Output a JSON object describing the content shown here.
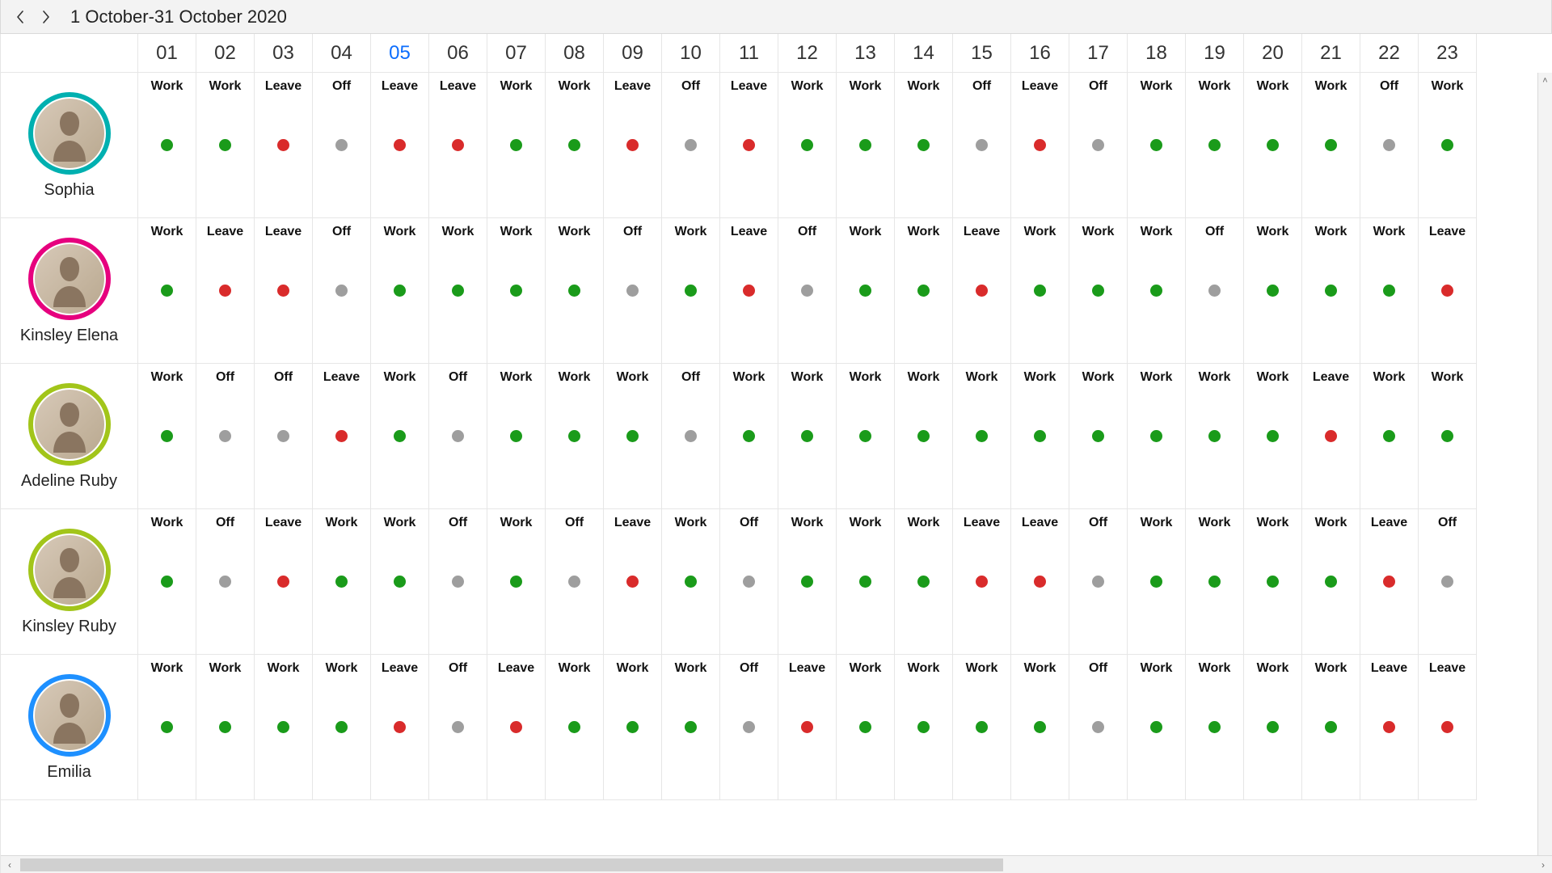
{
  "toolbar": {
    "date_range": "1 October-31 October 2020"
  },
  "today_index": 4,
  "days": [
    "01",
    "02",
    "03",
    "04",
    "05",
    "06",
    "07",
    "08",
    "09",
    "10",
    "11",
    "12",
    "13",
    "14",
    "15",
    "16",
    "17",
    "18",
    "19",
    "20",
    "21",
    "22",
    "23"
  ],
  "status_colors": {
    "Work": "#1a9b1a",
    "Leave": "#d92b2b",
    "Off": "#9e9e9e"
  },
  "employees": [
    {
      "name": "Sophia",
      "ring": "#00b0b0",
      "schedule": [
        "Work",
        "Work",
        "Leave",
        "Off",
        "Leave",
        "Leave",
        "Work",
        "Work",
        "Leave",
        "Off",
        "Leave",
        "Work",
        "Work",
        "Work",
        "Off",
        "Leave",
        "Off",
        "Work",
        "Work",
        "Work",
        "Work",
        "Off",
        "Work"
      ]
    },
    {
      "name": "Kinsley Elena",
      "ring": "#e6007e",
      "schedule": [
        "Work",
        "Leave",
        "Leave",
        "Off",
        "Work",
        "Work",
        "Work",
        "Work",
        "Off",
        "Work",
        "Leave",
        "Off",
        "Work",
        "Work",
        "Leave",
        "Work",
        "Work",
        "Work",
        "Off",
        "Work",
        "Work",
        "Work",
        "Leave"
      ]
    },
    {
      "name": "Adeline Ruby",
      "ring": "#a2c51a",
      "schedule": [
        "Work",
        "Off",
        "Off",
        "Leave",
        "Work",
        "Off",
        "Work",
        "Work",
        "Work",
        "Off",
        "Work",
        "Work",
        "Work",
        "Work",
        "Work",
        "Work",
        "Work",
        "Work",
        "Work",
        "Work",
        "Leave",
        "Work",
        "Work"
      ]
    },
    {
      "name": "Kinsley Ruby",
      "ring": "#a2c51a",
      "schedule": [
        "Work",
        "Off",
        "Leave",
        "Work",
        "Work",
        "Off",
        "Work",
        "Off",
        "Leave",
        "Work",
        "Off",
        "Work",
        "Work",
        "Work",
        "Leave",
        "Leave",
        "Off",
        "Work",
        "Work",
        "Work",
        "Work",
        "Leave",
        "Off"
      ]
    },
    {
      "name": "Emilia",
      "ring": "#1e90ff",
      "schedule": [
        "Work",
        "Work",
        "Work",
        "Work",
        "Leave",
        "Off",
        "Leave",
        "Work",
        "Work",
        "Work",
        "Off",
        "Leave",
        "Work",
        "Work",
        "Work",
        "Work",
        "Off",
        "Work",
        "Work",
        "Work",
        "Work",
        "Leave",
        "Leave"
      ]
    }
  ]
}
